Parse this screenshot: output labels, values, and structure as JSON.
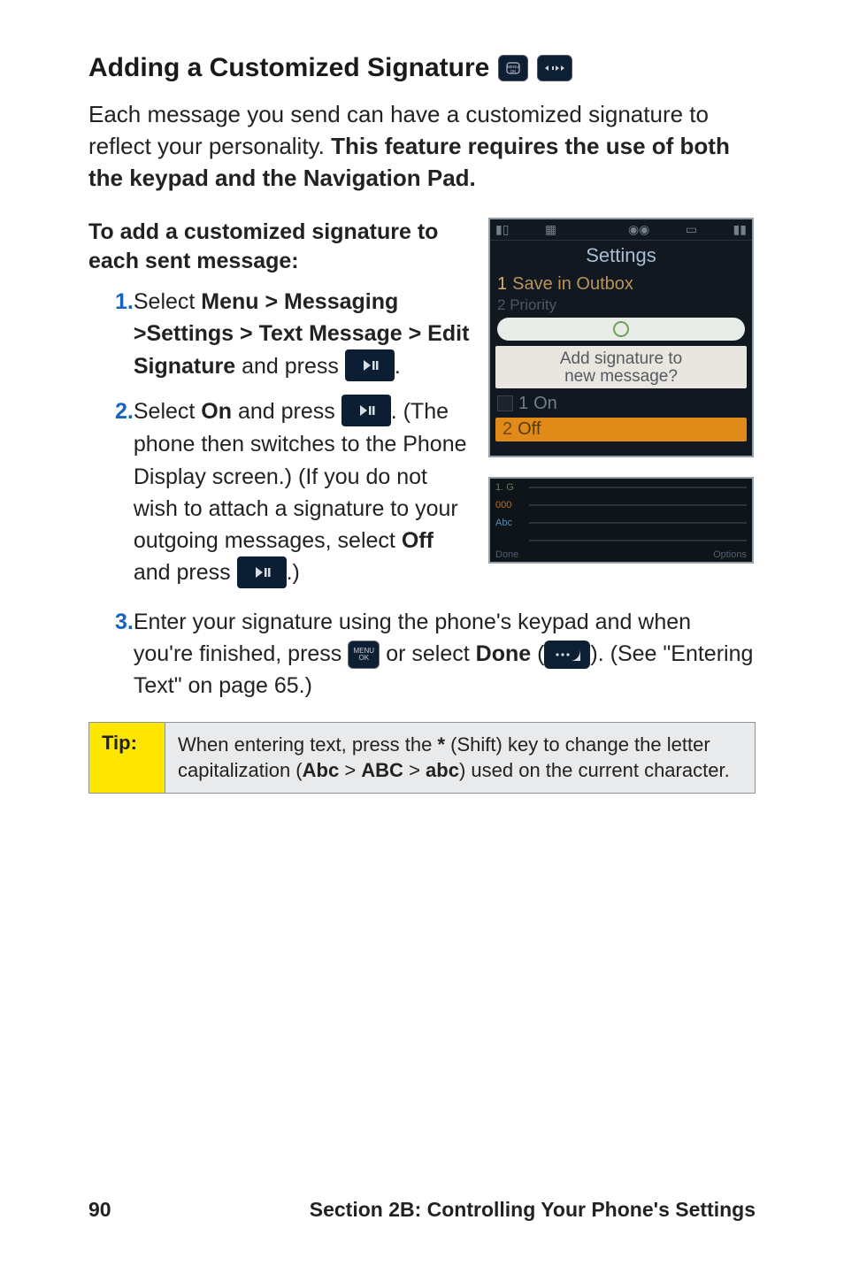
{
  "heading": "Adding a Customized Signature",
  "intro_a": "Each message you send can have a customized signature to reflect your personality. ",
  "intro_b": "This feature requires the use of both the keypad and the Navigation Pad.",
  "subhead": " To add a customized signature to each sent message:",
  "steps": {
    "n1": "1.",
    "s1a": "Select ",
    "s1b": "Menu > Messaging >Settings > Text Message > Edit Signature",
    "s1c": " and press ",
    "s1d": ".",
    "n2": "2.",
    "s2a": "Select ",
    "s2b": "On",
    "s2c": " and press ",
    "s2d": ". (The phone then switches to the Phone Display screen.) (If you do not wish to attach a signature to your outgoing messages, select ",
    "s2e": "Off",
    "s2f": " and press ",
    "s2g": ".)",
    "n3": "3.",
    "s3a": "Enter your signature using the phone's keypad and when you're finished, press ",
    "s3b": " or select ",
    "s3c": "Done",
    "s3d": " (",
    "s3e": "). (See \"Entering Text\" on page 65.)"
  },
  "tip": {
    "label": "Tip:",
    "a": "When entering text, press the ",
    "star": "*",
    "b": " (Shift) key to change the letter capitalization (",
    "c1": "Abc",
    "sep": " > ",
    "c2": "ABC",
    "c3": "abc",
    "d": ") used on the current character."
  },
  "screenshot": {
    "title": "Settings",
    "row1_num": "1",
    "row1": "Save in Outbox",
    "row2_num": "2",
    "row2": "Priority",
    "card1": "Add signature to",
    "card2": "new message?",
    "on_num": "1",
    "on": "On",
    "off_num": "2",
    "off": "Off",
    "options": "Options",
    "done": "Done",
    "lbls": {
      "a": "1. G",
      "b": "000",
      "c": "Abc",
      "d": ""
    }
  },
  "footer": {
    "page": "90",
    "section": "Section 2B: Controlling Your Phone's Settings"
  },
  "menu_key": "MENU\nOK"
}
